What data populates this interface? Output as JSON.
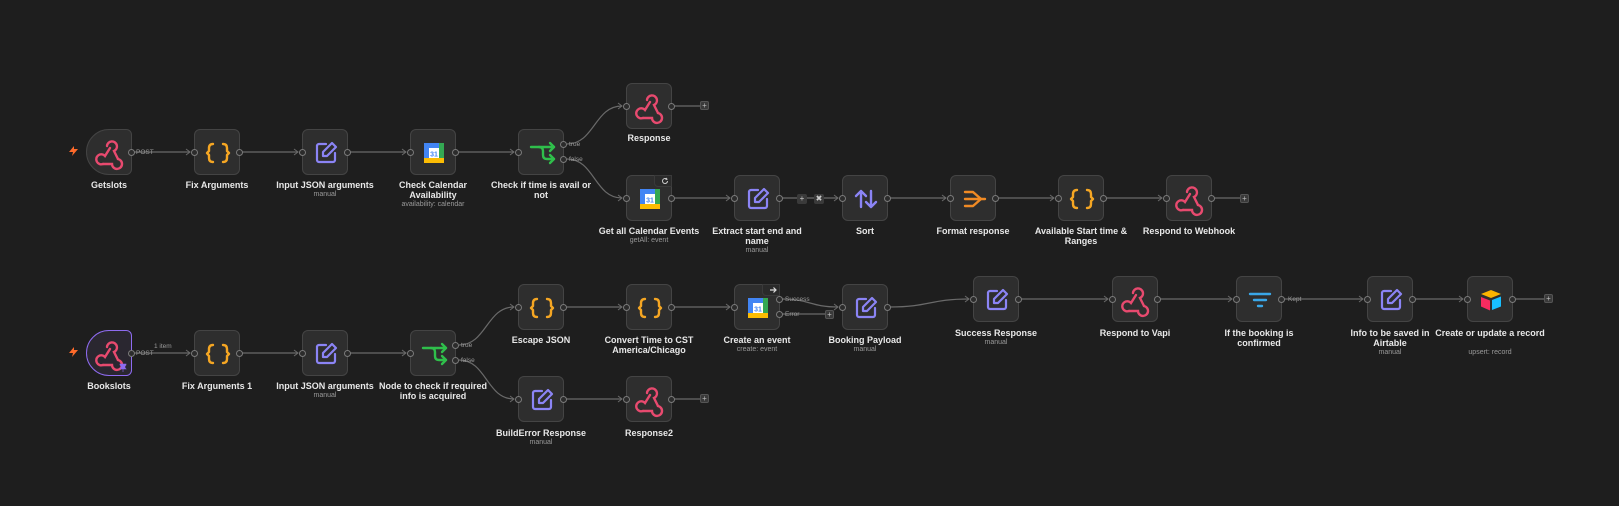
{
  "nodes": [
    {
      "id": "getslots",
      "label": "Getslots",
      "sub": "",
      "icon": "webhook",
      "trigger": true
    },
    {
      "id": "fix-arguments",
      "label": "Fix Arguments",
      "sub": "",
      "icon": "code"
    },
    {
      "id": "input-json-1",
      "label": "Input JSON arguments",
      "sub": "manual",
      "icon": "edit"
    },
    {
      "id": "check-calendar",
      "label": "Check Calendar Availability",
      "sub": "availability: calendar",
      "icon": "gcal"
    },
    {
      "id": "check-time",
      "label": "Check if time is avail or not",
      "sub": "",
      "icon": "if"
    },
    {
      "id": "response",
      "label": "Response",
      "sub": "",
      "icon": "webhook"
    },
    {
      "id": "get-calendar-events",
      "label": "Get all Calendar Events",
      "sub": "getAll: event",
      "icon": "gcal"
    },
    {
      "id": "extract-start",
      "label": "Extract start end and name",
      "sub": "manual",
      "icon": "edit"
    },
    {
      "id": "sort",
      "label": "Sort",
      "sub": "",
      "icon": "sort"
    },
    {
      "id": "format-response",
      "label": "Format response",
      "sub": "",
      "icon": "merge"
    },
    {
      "id": "available-start",
      "label": "Available Start time & Ranges",
      "sub": "",
      "icon": "code"
    },
    {
      "id": "respond-webhook",
      "label": "Respond to Webhook",
      "sub": "",
      "icon": "webhook"
    },
    {
      "id": "bookslots",
      "label": "Bookslots",
      "sub": "",
      "icon": "webhook",
      "trigger": true,
      "selected": true
    },
    {
      "id": "fix-arguments-1",
      "label": "Fix Arguments 1",
      "sub": "",
      "icon": "code"
    },
    {
      "id": "input-json-2",
      "label": "Input JSON arguments",
      "sub": "manual",
      "icon": "edit"
    },
    {
      "id": "node-check",
      "label": "Node to check if required info is acquired",
      "sub": "",
      "icon": "if"
    },
    {
      "id": "escape-json",
      "label": "Escape JSON",
      "sub": "",
      "icon": "code"
    },
    {
      "id": "convert-time",
      "label": "Convert Time to CST America/Chicago",
      "sub": "",
      "icon": "code"
    },
    {
      "id": "create-event",
      "label": "Create an event",
      "sub": "create: event",
      "icon": "gcal"
    },
    {
      "id": "booking-payload",
      "label": "Booking Payload",
      "sub": "manual",
      "icon": "edit"
    },
    {
      "id": "success-response",
      "label": "Success Response",
      "sub": "manual",
      "icon": "edit"
    },
    {
      "id": "respond-vapi",
      "label": "Respond to Vapi",
      "sub": "",
      "icon": "webhook"
    },
    {
      "id": "if-booking",
      "label": "If the booking is confirmed",
      "sub": "",
      "icon": "filter"
    },
    {
      "id": "info-airtable",
      "label": "Info to be saved in Airtable",
      "sub": "manual",
      "icon": "edit"
    },
    {
      "id": "create-record",
      "label": "Create or update a record",
      "sub": "upsert: record",
      "icon": "airtable"
    },
    {
      "id": "builderror",
      "label": "BuildError Response",
      "sub": "manual",
      "icon": "edit"
    },
    {
      "id": "response2",
      "label": "Response2",
      "sub": "",
      "icon": "webhook"
    }
  ],
  "edge_labels": {
    "post1": "POST",
    "true1": "true",
    "false1": "false",
    "item1": "1 item",
    "post2": "POST",
    "true2": "true",
    "false2": "false",
    "success": "Success",
    "error": "Error",
    "kept": "Kept"
  },
  "colors": {
    "background": "#1e1e1e",
    "node": "#2e2e2e",
    "selected": "#8e6bf0",
    "webhook": "#e84a6f",
    "code": "#f5a623",
    "edit": "#8b84f5",
    "if": "#2fbf4b",
    "merge": "#f08a24",
    "filter": "#3aa7e8"
  }
}
